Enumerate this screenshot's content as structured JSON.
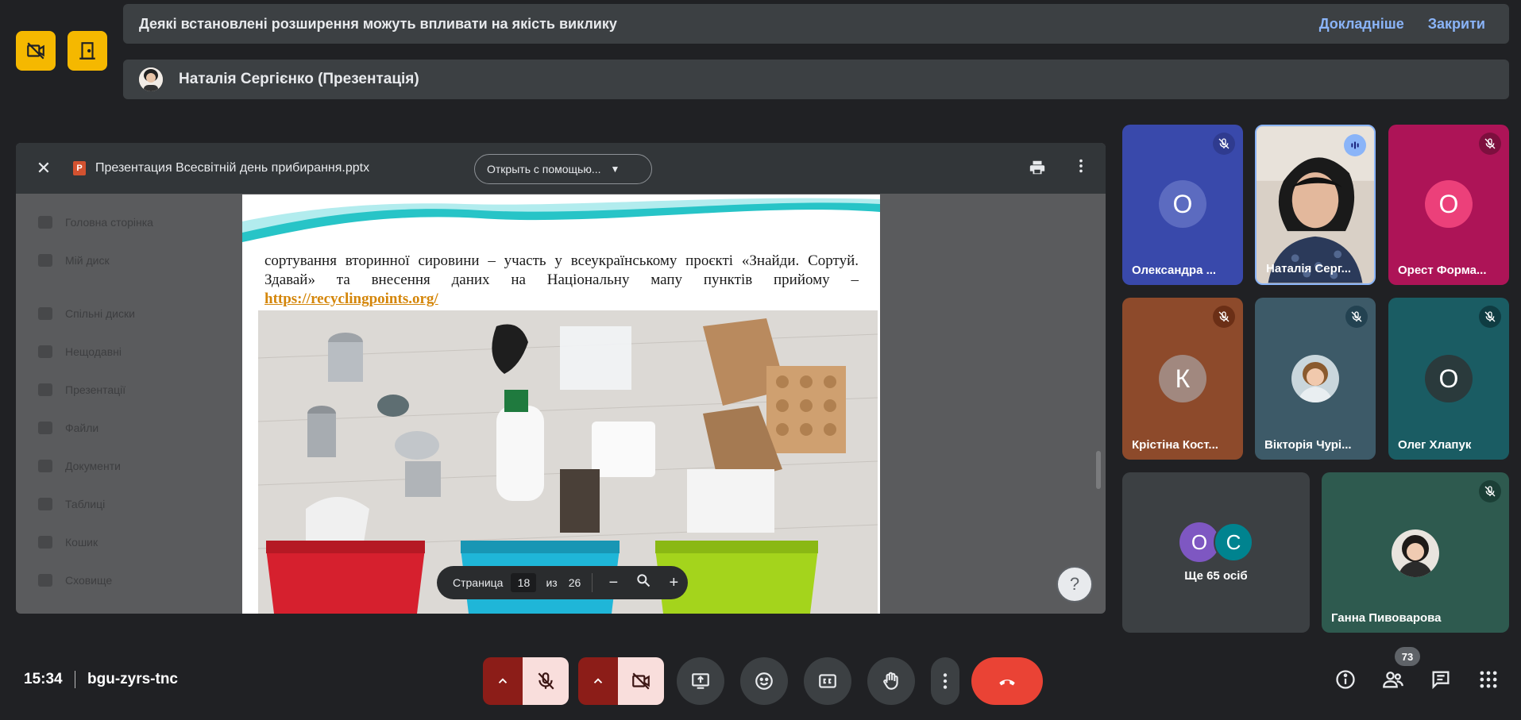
{
  "banner": {
    "warning_text": "Деякі встановлені розширення можуть впливати на якість виклику",
    "more_link": "Докладніше",
    "close_link": "Закрити",
    "presenter_text": "Наталія Сергієнко (Презентація)"
  },
  "viewer": {
    "file_name": "Презентация Всесвітній день прибирання.pptx",
    "open_with": "Открыть с помощью...",
    "slide_text": "сортування вторинної сировини – участь у всеукраїнському проєкті «Знайди. Сортуй. Здавай» та внесення даних на Національну мапу пунктів прийому –",
    "slide_link": "https://recyclingpoints.org/",
    "page_label": "Страница",
    "page_current": "18",
    "page_of": "из",
    "page_total": "26",
    "zoom_out": "−",
    "zoom_in": "+",
    "help": "?"
  },
  "participants": [
    {
      "name": "Олександра ...",
      "initial": "О",
      "bg": "#3949ab",
      "muted": true
    },
    {
      "name": "Наталія Серг...",
      "photo": true,
      "speaking": true
    },
    {
      "name": "Орест Форма...",
      "initial": "О",
      "bg": "#ad1457",
      "muted": true
    },
    {
      "name": "Крістіна Кост...",
      "initial": "К",
      "bg": "#8d4a2b",
      "muted": true
    },
    {
      "name": "Вікторія Чурі...",
      "photo": true,
      "muted": true
    },
    {
      "name": "Олег Хлапук",
      "initial": "О",
      "bg": "#1a5c63",
      "muted": true
    }
  ],
  "others": {
    "label": "Ще 65 осіб",
    "initial_1": "О",
    "initial_2": "С"
  },
  "pinned": {
    "name": "Ганна Пивоварова",
    "muted": true
  },
  "footer": {
    "time": "15:34",
    "meeting_code": "bgu-zyrs-tnc",
    "people_count": "73"
  },
  "colors": {
    "accent_yellow": "#f5b800",
    "end_call": "#ea4335",
    "link": "#8ab4f8"
  }
}
